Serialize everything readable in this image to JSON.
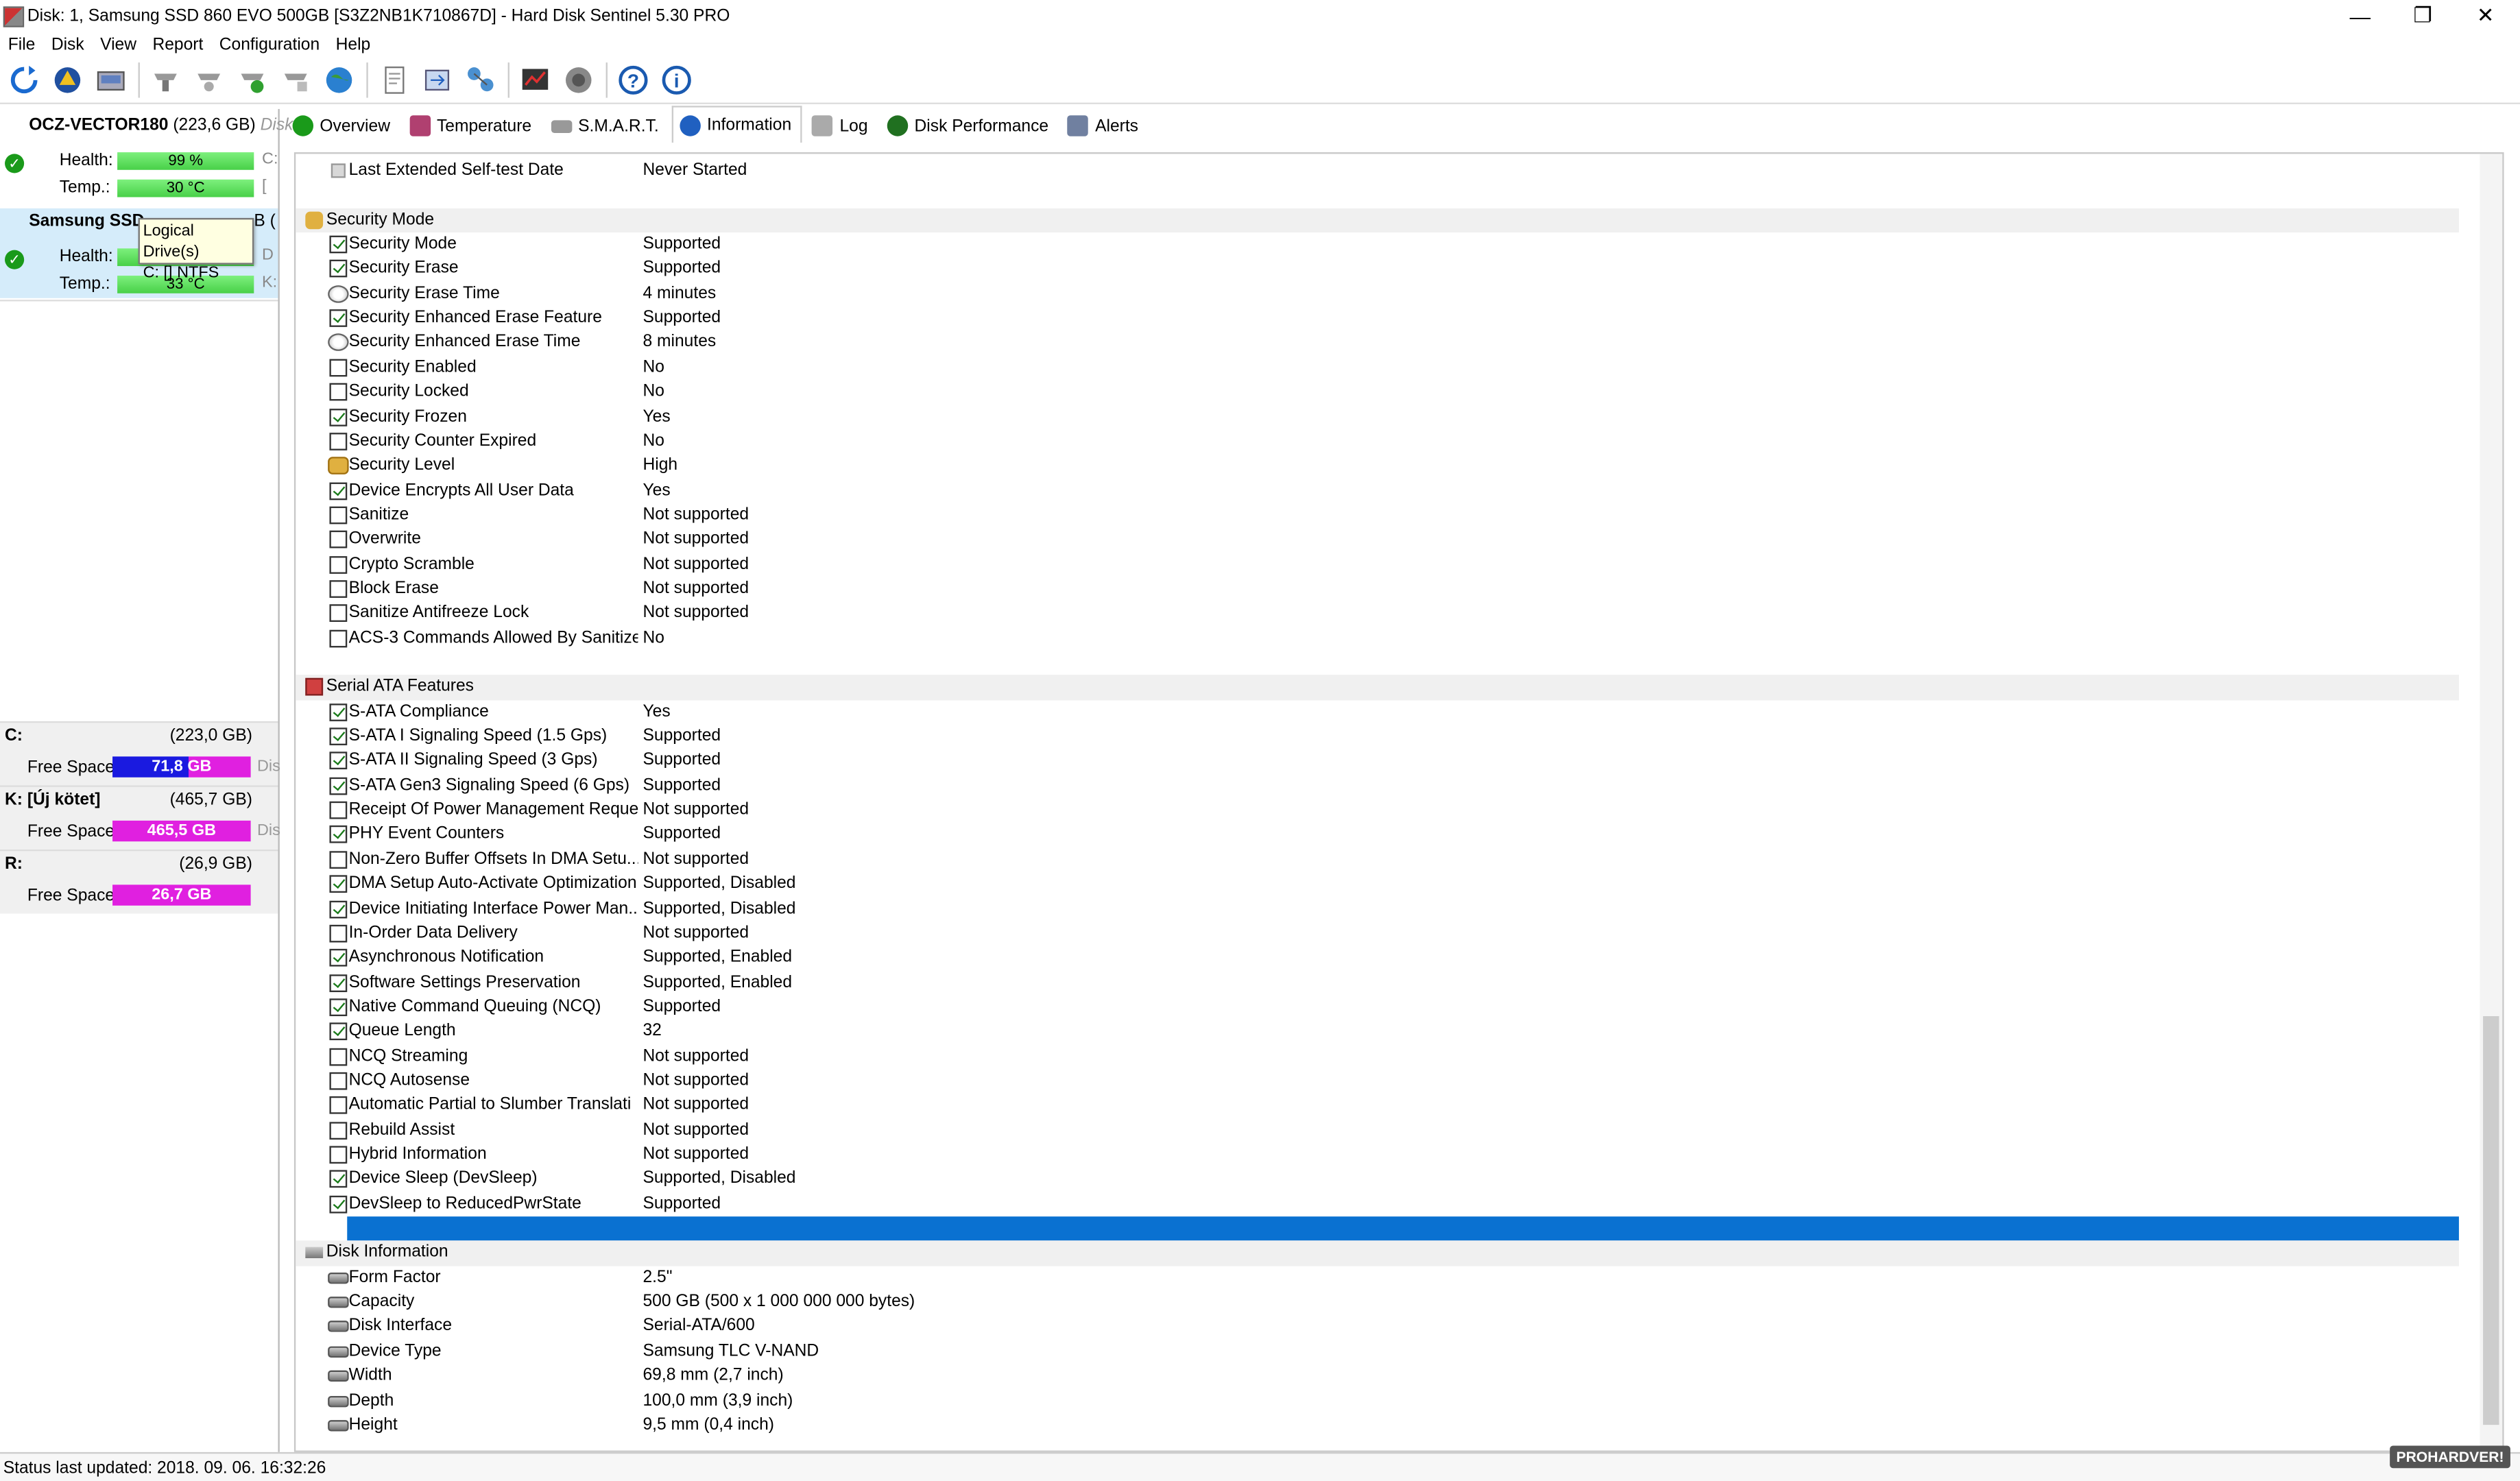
{
  "window": {
    "title": "Disk: 1, Samsung SSD 860 EVO 500GB [S3Z2NB1K710867D]  -  Hard Disk Sentinel 5.30 PRO",
    "minimize": "—",
    "maximize": "❐",
    "close": "✕"
  },
  "menu": [
    "File",
    "Disk",
    "View",
    "Report",
    "Configuration",
    "Help"
  ],
  "toolbar_icons": [
    "refresh-icon",
    "alert-icon",
    "drive-icon",
    "test-icon",
    "test2-icon",
    "test3-icon",
    "test4-icon",
    "globe-icon",
    "report-icon",
    "send-icon",
    "network-icon",
    "benchmark-icon",
    "speaker-icon",
    "help-icon",
    "info-icon"
  ],
  "disks": [
    {
      "name": "OCZ-VECTOR180",
      "size": "(223,6 GB)",
      "cut": "Disk",
      "health_label": "Health:",
      "health": "99 %",
      "health_pct": 99,
      "temp_label": "Temp.:",
      "temp": "30 °C",
      "health_suffix": "C:",
      "temp_suffix": "["
    },
    {
      "name": "Samsung SSD",
      "size": "B (",
      "cut": "",
      "health_label": "Health:",
      "health": "",
      "health_pct": 100,
      "temp_label": "Temp.:",
      "temp": "33 °C",
      "health_suffix": "D",
      "temp_suffix": "K:"
    }
  ],
  "tooltip": {
    "line1": "Logical Drive(s)",
    "line2": "C: [] NTFS"
  },
  "volumes": [
    {
      "letter": "C:",
      "size": "(223,0 GB)",
      "free_label": "Free Space",
      "free": "71,8 GB",
      "cut": "Dis",
      "color": "#1a1ae0",
      "color2": "#e020e0"
    },
    {
      "letter": "K: [Új kötet]",
      "size": "(465,7 GB)",
      "free_label": "Free Space",
      "free": "465,5 GB",
      "cut": "Dis",
      "color": "#e020e0",
      "color2": "#e020e0"
    },
    {
      "letter": "R:",
      "size": "(26,9 GB)",
      "free_label": "Free Space",
      "free": "26,7 GB",
      "cut": "",
      "color": "#e020e0",
      "color2": "#e020e0"
    }
  ],
  "tabs": [
    {
      "label": "Overview",
      "icon": "check-icon",
      "color": "#1a9a1a"
    },
    {
      "label": "Temperature",
      "icon": "thermometer-icon",
      "color": "#b04070"
    },
    {
      "label": "S.M.A.R.T.",
      "icon": "disk-icon",
      "color": "#888888"
    },
    {
      "label": "Information",
      "icon": "info-icon",
      "color": "#2060c0"
    },
    {
      "label": "Log",
      "icon": "log-icon",
      "color": "#888888"
    },
    {
      "label": "Disk Performance",
      "icon": "gauge-icon",
      "color": "#207020"
    },
    {
      "label": "Alerts",
      "icon": "alerts-icon",
      "color": "#607090"
    }
  ],
  "rows": [
    {
      "type": "item",
      "icon": "dot",
      "label": "Last Extended Self-test Date",
      "value": "Never Started"
    },
    {
      "type": "blank"
    },
    {
      "type": "section",
      "label": "Security Mode",
      "icon": "lock"
    },
    {
      "type": "item",
      "icon": "on",
      "label": "Security Mode",
      "value": "Supported"
    },
    {
      "type": "item",
      "icon": "on",
      "label": "Security Erase",
      "value": "Supported"
    },
    {
      "type": "item",
      "icon": "clock",
      "label": "Security Erase Time",
      "value": "4 minutes"
    },
    {
      "type": "item",
      "icon": "on",
      "label": "Security Enhanced Erase Feature",
      "value": "Supported"
    },
    {
      "type": "item",
      "icon": "clock",
      "label": "Security Enhanced Erase Time",
      "value": "8 minutes"
    },
    {
      "type": "item",
      "icon": "off",
      "label": "Security Enabled",
      "value": "No"
    },
    {
      "type": "item",
      "icon": "off",
      "label": "Security Locked",
      "value": "No"
    },
    {
      "type": "item",
      "icon": "on",
      "label": "Security Frozen",
      "value": "Yes"
    },
    {
      "type": "item",
      "icon": "off",
      "label": "Security Counter Expired",
      "value": "No"
    },
    {
      "type": "item",
      "icon": "lock",
      "label": "Security Level",
      "value": "High"
    },
    {
      "type": "item",
      "icon": "on",
      "label": "Device Encrypts All User Data",
      "value": "Yes"
    },
    {
      "type": "item",
      "icon": "off",
      "label": "Sanitize",
      "value": "Not supported"
    },
    {
      "type": "item",
      "icon": "off",
      "label": "Overwrite",
      "value": "Not supported"
    },
    {
      "type": "item",
      "icon": "off",
      "label": "Crypto Scramble",
      "value": "Not supported"
    },
    {
      "type": "item",
      "icon": "off",
      "label": "Block Erase",
      "value": "Not supported"
    },
    {
      "type": "item",
      "icon": "off",
      "label": "Sanitize Antifreeze Lock",
      "value": "Not supported"
    },
    {
      "type": "item",
      "icon": "off",
      "label": "ACS-3 Commands Allowed By Sanitize",
      "value": "No"
    },
    {
      "type": "blank"
    },
    {
      "type": "section",
      "label": "Serial ATA Features",
      "icon": "sata"
    },
    {
      "type": "item",
      "icon": "on",
      "label": "S-ATA Compliance",
      "value": "Yes"
    },
    {
      "type": "item",
      "icon": "on",
      "label": "S-ATA I Signaling Speed (1.5 Gps)",
      "value": "Supported"
    },
    {
      "type": "item",
      "icon": "on",
      "label": "S-ATA II Signaling Speed (3 Gps)",
      "value": "Supported"
    },
    {
      "type": "item",
      "icon": "on",
      "label": "S-ATA Gen3 Signaling Speed (6 Gps)",
      "value": "Supported"
    },
    {
      "type": "item",
      "icon": "off",
      "label": "Receipt Of Power Management Reque...",
      "value": "Not supported"
    },
    {
      "type": "item",
      "icon": "on",
      "label": "PHY Event Counters",
      "value": "Supported"
    },
    {
      "type": "item",
      "icon": "off",
      "label": "Non-Zero Buffer Offsets In DMA Setu...",
      "value": "Not supported"
    },
    {
      "type": "item",
      "icon": "on",
      "label": "DMA Setup Auto-Activate Optimization",
      "value": "Supported, Disabled"
    },
    {
      "type": "item",
      "icon": "on",
      "label": "Device Initiating Interface Power Man...",
      "value": "Supported, Disabled"
    },
    {
      "type": "item",
      "icon": "off",
      "label": "In-Order Data Delivery",
      "value": "Not supported"
    },
    {
      "type": "item",
      "icon": "on",
      "label": "Asynchronous Notification",
      "value": "Supported, Enabled"
    },
    {
      "type": "item",
      "icon": "on",
      "label": "Software Settings Preservation",
      "value": "Supported, Enabled"
    },
    {
      "type": "item",
      "icon": "on",
      "label": "Native Command Queuing (NCQ)",
      "value": "Supported"
    },
    {
      "type": "item",
      "icon": "on",
      "label": "Queue Length",
      "value": "32"
    },
    {
      "type": "item",
      "icon": "off",
      "label": "NCQ Streaming",
      "value": "Not supported"
    },
    {
      "type": "item",
      "icon": "off",
      "label": "NCQ Autosense",
      "value": "Not supported"
    },
    {
      "type": "item",
      "icon": "off",
      "label": "Automatic Partial to Slumber Translati",
      "value": "Not supported"
    },
    {
      "type": "item",
      "icon": "off",
      "label": "Rebuild Assist",
      "value": "Not supported"
    },
    {
      "type": "item",
      "icon": "off",
      "label": "Hybrid Information",
      "value": "Not supported"
    },
    {
      "type": "item",
      "icon": "on",
      "label": "Device Sleep (DevSleep)",
      "value": "Supported, Disabled"
    },
    {
      "type": "item",
      "icon": "on",
      "label": "DevSleep to ReducedPwrState",
      "value": "Supported"
    },
    {
      "type": "selected"
    },
    {
      "type": "section",
      "label": "Disk Information",
      "icon": "disk"
    },
    {
      "type": "item",
      "icon": "disk",
      "label": "Form Factor",
      "value": "2.5\""
    },
    {
      "type": "item",
      "icon": "disk",
      "label": "Capacity",
      "value": "500 GB (500 x 1 000 000 000 bytes)"
    },
    {
      "type": "item",
      "icon": "disk",
      "label": "Disk Interface",
      "value": "Serial-ATA/600"
    },
    {
      "type": "item",
      "icon": "disk",
      "label": "Device Type",
      "value": "Samsung TLC V-NAND"
    },
    {
      "type": "item",
      "icon": "disk",
      "label": "Width",
      "value": "69,8 mm (2,7 inch)"
    },
    {
      "type": "item",
      "icon": "disk",
      "label": "Depth",
      "value": "100,0 mm (3,9 inch)"
    },
    {
      "type": "item",
      "icon": "disk",
      "label": "Height",
      "value": "9,5 mm (0,4 inch)"
    }
  ],
  "status": "Status last updated: 2018. 09. 06. 16:32:26",
  "watermark": "PROHARDVER!"
}
